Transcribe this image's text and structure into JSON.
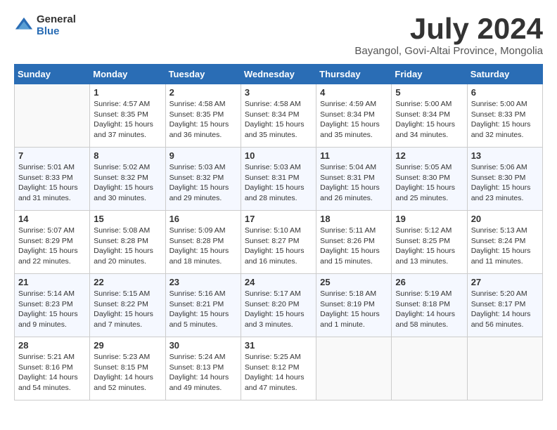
{
  "header": {
    "logo_general": "General",
    "logo_blue": "Blue",
    "month_title": "July 2024",
    "location": "Bayangol, Govi-Altai Province, Mongolia"
  },
  "days_of_week": [
    "Sunday",
    "Monday",
    "Tuesday",
    "Wednesday",
    "Thursday",
    "Friday",
    "Saturday"
  ],
  "weeks": [
    [
      {
        "day": "",
        "content": ""
      },
      {
        "day": "1",
        "content": "Sunrise: 4:57 AM\nSunset: 8:35 PM\nDaylight: 15 hours\nand 37 minutes."
      },
      {
        "day": "2",
        "content": "Sunrise: 4:58 AM\nSunset: 8:35 PM\nDaylight: 15 hours\nand 36 minutes."
      },
      {
        "day": "3",
        "content": "Sunrise: 4:58 AM\nSunset: 8:34 PM\nDaylight: 15 hours\nand 35 minutes."
      },
      {
        "day": "4",
        "content": "Sunrise: 4:59 AM\nSunset: 8:34 PM\nDaylight: 15 hours\nand 35 minutes."
      },
      {
        "day": "5",
        "content": "Sunrise: 5:00 AM\nSunset: 8:34 PM\nDaylight: 15 hours\nand 34 minutes."
      },
      {
        "day": "6",
        "content": "Sunrise: 5:00 AM\nSunset: 8:33 PM\nDaylight: 15 hours\nand 32 minutes."
      }
    ],
    [
      {
        "day": "7",
        "content": "Sunrise: 5:01 AM\nSunset: 8:33 PM\nDaylight: 15 hours\nand 31 minutes."
      },
      {
        "day": "8",
        "content": "Sunrise: 5:02 AM\nSunset: 8:32 PM\nDaylight: 15 hours\nand 30 minutes."
      },
      {
        "day": "9",
        "content": "Sunrise: 5:03 AM\nSunset: 8:32 PM\nDaylight: 15 hours\nand 29 minutes."
      },
      {
        "day": "10",
        "content": "Sunrise: 5:03 AM\nSunset: 8:31 PM\nDaylight: 15 hours\nand 28 minutes."
      },
      {
        "day": "11",
        "content": "Sunrise: 5:04 AM\nSunset: 8:31 PM\nDaylight: 15 hours\nand 26 minutes."
      },
      {
        "day": "12",
        "content": "Sunrise: 5:05 AM\nSunset: 8:30 PM\nDaylight: 15 hours\nand 25 minutes."
      },
      {
        "day": "13",
        "content": "Sunrise: 5:06 AM\nSunset: 8:30 PM\nDaylight: 15 hours\nand 23 minutes."
      }
    ],
    [
      {
        "day": "14",
        "content": "Sunrise: 5:07 AM\nSunset: 8:29 PM\nDaylight: 15 hours\nand 22 minutes."
      },
      {
        "day": "15",
        "content": "Sunrise: 5:08 AM\nSunset: 8:28 PM\nDaylight: 15 hours\nand 20 minutes."
      },
      {
        "day": "16",
        "content": "Sunrise: 5:09 AM\nSunset: 8:28 PM\nDaylight: 15 hours\nand 18 minutes."
      },
      {
        "day": "17",
        "content": "Sunrise: 5:10 AM\nSunset: 8:27 PM\nDaylight: 15 hours\nand 16 minutes."
      },
      {
        "day": "18",
        "content": "Sunrise: 5:11 AM\nSunset: 8:26 PM\nDaylight: 15 hours\nand 15 minutes."
      },
      {
        "day": "19",
        "content": "Sunrise: 5:12 AM\nSunset: 8:25 PM\nDaylight: 15 hours\nand 13 minutes."
      },
      {
        "day": "20",
        "content": "Sunrise: 5:13 AM\nSunset: 8:24 PM\nDaylight: 15 hours\nand 11 minutes."
      }
    ],
    [
      {
        "day": "21",
        "content": "Sunrise: 5:14 AM\nSunset: 8:23 PM\nDaylight: 15 hours\nand 9 minutes."
      },
      {
        "day": "22",
        "content": "Sunrise: 5:15 AM\nSunset: 8:22 PM\nDaylight: 15 hours\nand 7 minutes."
      },
      {
        "day": "23",
        "content": "Sunrise: 5:16 AM\nSunset: 8:21 PM\nDaylight: 15 hours\nand 5 minutes."
      },
      {
        "day": "24",
        "content": "Sunrise: 5:17 AM\nSunset: 8:20 PM\nDaylight: 15 hours\nand 3 minutes."
      },
      {
        "day": "25",
        "content": "Sunrise: 5:18 AM\nSunset: 8:19 PM\nDaylight: 15 hours\nand 1 minute."
      },
      {
        "day": "26",
        "content": "Sunrise: 5:19 AM\nSunset: 8:18 PM\nDaylight: 14 hours\nand 58 minutes."
      },
      {
        "day": "27",
        "content": "Sunrise: 5:20 AM\nSunset: 8:17 PM\nDaylight: 14 hours\nand 56 minutes."
      }
    ],
    [
      {
        "day": "28",
        "content": "Sunrise: 5:21 AM\nSunset: 8:16 PM\nDaylight: 14 hours\nand 54 minutes."
      },
      {
        "day": "29",
        "content": "Sunrise: 5:23 AM\nSunset: 8:15 PM\nDaylight: 14 hours\nand 52 minutes."
      },
      {
        "day": "30",
        "content": "Sunrise: 5:24 AM\nSunset: 8:13 PM\nDaylight: 14 hours\nand 49 minutes."
      },
      {
        "day": "31",
        "content": "Sunrise: 5:25 AM\nSunset: 8:12 PM\nDaylight: 14 hours\nand 47 minutes."
      },
      {
        "day": "",
        "content": ""
      },
      {
        "day": "",
        "content": ""
      },
      {
        "day": "",
        "content": ""
      }
    ]
  ]
}
